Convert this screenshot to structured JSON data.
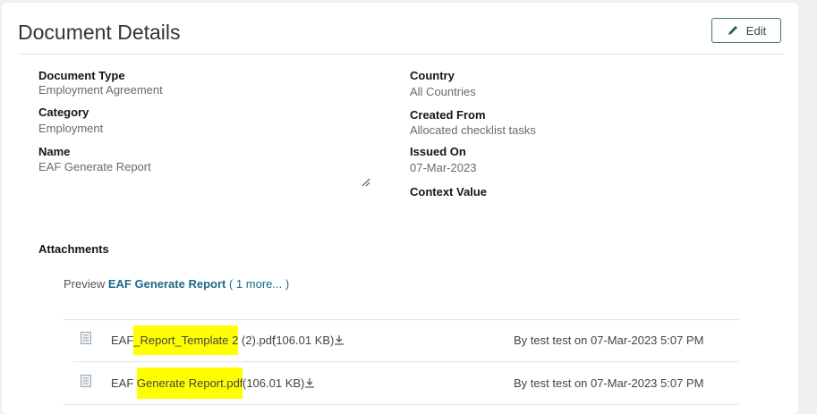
{
  "header": {
    "title": "Document Details",
    "edit_label": "Edit"
  },
  "fields_left": [
    {
      "label": "Document Type",
      "value": "Employment Agreement"
    },
    {
      "label": "Category",
      "value": "Employment"
    },
    {
      "label": "Name",
      "value": "EAF Generate Report"
    }
  ],
  "fields_right": [
    {
      "label": "Country",
      "value": "All Countries"
    },
    {
      "label": "Created From",
      "value": "Allocated checklist tasks"
    },
    {
      "label": "Issued On",
      "value": "07-Mar-2023"
    },
    {
      "label": "Context Value",
      "value": ""
    }
  ],
  "attachments": {
    "heading": "Attachments",
    "preview_label": "Preview",
    "preview_link": "EAF Generate Report",
    "more_link": "( 1 more... )",
    "files": [
      {
        "name_pre": "EAF",
        "name_hl": "_Report_Template 2",
        "name_post": " (2).pdf",
        "size": "(106.01 KB)",
        "meta": "By test test on 07-Mar-2023 5:07 PM"
      },
      {
        "name_pre": "EAF ",
        "name_hl": "Generate Report.pdf",
        "name_post": "",
        "size": "(106.01 KB)",
        "meta": "By test test on 07-Mar-2023 5:07 PM"
      }
    ]
  },
  "colors": {
    "highlight": "#ffff00",
    "link": "#1c6a8a",
    "edit_border": "#3d7a66"
  }
}
